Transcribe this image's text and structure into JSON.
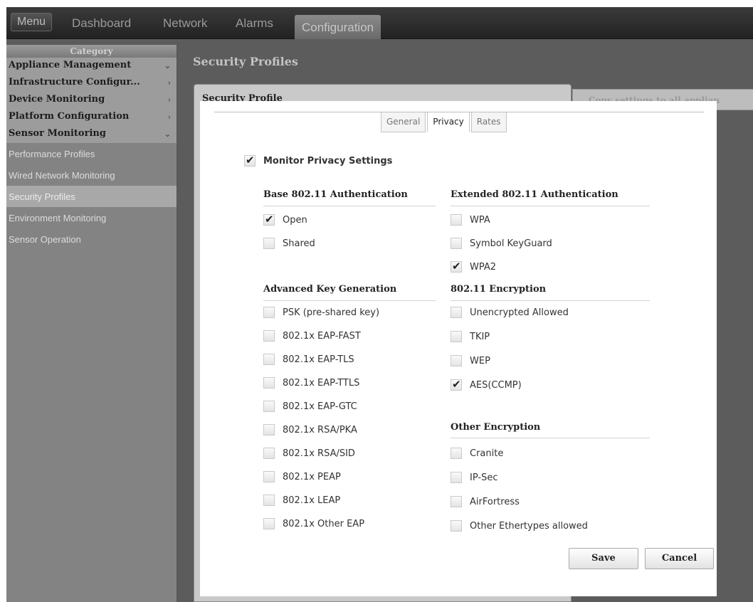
{
  "topbar": {
    "menu": "Menu",
    "tabs": [
      "Dashboard",
      "Network",
      "Alarms",
      "Configuration"
    ]
  },
  "sidebar": {
    "category_header": "Category",
    "groups": [
      {
        "label": "Appliance Management",
        "chevron": "⌄"
      },
      {
        "label": "Infrastructure Configur...",
        "chevron": "›"
      },
      {
        "label": "Device Monitoring",
        "chevron": "›"
      },
      {
        "label": "Platform Configuration",
        "chevron": "›"
      },
      {
        "label": "Sensor Monitoring",
        "chevron": "⌄"
      }
    ],
    "items": [
      "Performance Profiles",
      "Wired Network Monitoring",
      "Security Profiles",
      "Environment Monitoring",
      "Sensor Operation"
    ]
  },
  "main": {
    "title": "Security Profiles",
    "copy_button": "Copy settings to all applian"
  },
  "dialog": {
    "title": "Security Profile",
    "close": "×",
    "tabs": [
      "General",
      "Privacy",
      "Rates"
    ],
    "monitor_privacy": {
      "label": "Monitor Privacy Settings",
      "checked": true
    },
    "base_auth": {
      "header": "Base 802.11 Authentication",
      "options": [
        {
          "label": "Open",
          "checked": true
        },
        {
          "label": "Shared",
          "checked": false
        }
      ]
    },
    "ext_auth": {
      "header": "Extended 802.11 Authentication",
      "options": [
        {
          "label": "WPA",
          "checked": false
        },
        {
          "label": "Symbol KeyGuard",
          "checked": false
        },
        {
          "label": "WPA2",
          "checked": true
        }
      ]
    },
    "adv_key": {
      "header": "Advanced Key Generation",
      "options": [
        {
          "label": "PSK (pre-shared key)",
          "checked": false
        },
        {
          "label": "802.1x EAP-FAST",
          "checked": false
        },
        {
          "label": "802.1x EAP-TLS",
          "checked": false
        },
        {
          "label": "802.1x EAP-TTLS",
          "checked": false
        },
        {
          "label": "802.1x EAP-GTC",
          "checked": false
        },
        {
          "label": "802.1x RSA/PKA",
          "checked": false
        },
        {
          "label": "802.1x RSA/SID",
          "checked": false
        },
        {
          "label": "802.1x PEAP",
          "checked": false
        },
        {
          "label": "802.1x LEAP",
          "checked": false
        },
        {
          "label": "802.1x Other EAP",
          "checked": false
        }
      ]
    },
    "encryption": {
      "header": "802.11 Encryption",
      "options": [
        {
          "label": "Unencrypted Allowed",
          "checked": false
        },
        {
          "label": "TKIP",
          "checked": false
        },
        {
          "label": "WEP",
          "checked": false
        },
        {
          "label": "AES(CCMP)",
          "checked": true
        }
      ]
    },
    "other_enc": {
      "header": "Other Encryption",
      "options": [
        {
          "label": "Cranite",
          "checked": false
        },
        {
          "label": "IP-Sec",
          "checked": false
        },
        {
          "label": "AirFortress",
          "checked": false
        },
        {
          "label": "Other Ethertypes allowed",
          "checked": false
        }
      ]
    },
    "save": "Save",
    "cancel": "Cancel"
  }
}
